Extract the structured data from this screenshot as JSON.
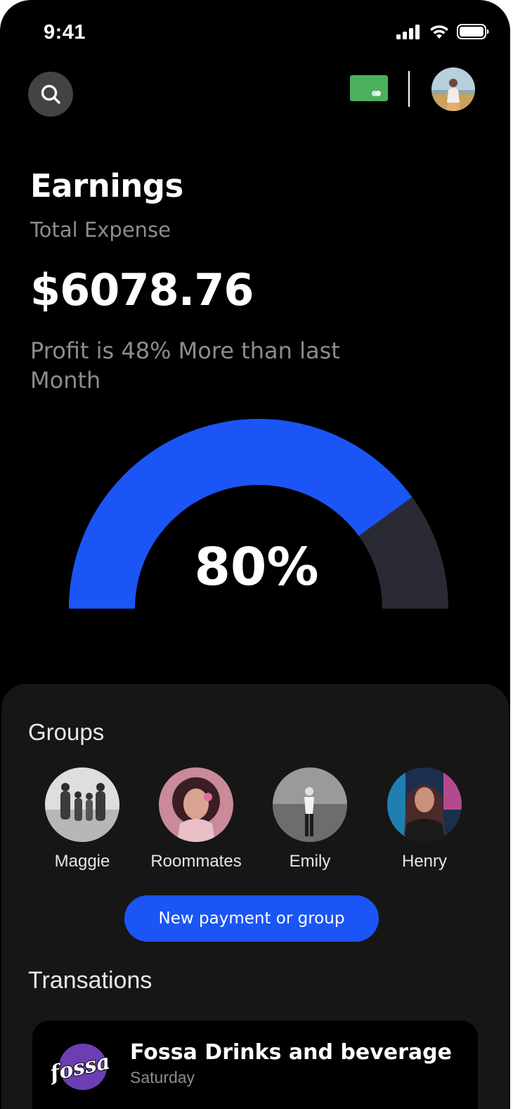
{
  "status_bar": {
    "time": "9:41"
  },
  "header": {
    "icons": [
      "search-icon",
      "card-icon",
      "profile-avatar"
    ]
  },
  "earnings": {
    "title": "Earnings",
    "subtitle": "Total Expense",
    "amount": "$6078.76",
    "profit_note": "Profit is 48% More than last Month",
    "progress_percent": 80,
    "progress_label": "80%"
  },
  "colors": {
    "accent": "#1b55f5",
    "gauge_track": "#2a2a35",
    "card_green": "#4caf5e",
    "sheet_bg": "#161616"
  },
  "groups": {
    "title": "Groups",
    "items": [
      {
        "label": "Maggie"
      },
      {
        "label": "Roommates"
      },
      {
        "label": "Emily"
      },
      {
        "label": "Henry"
      }
    ]
  },
  "actions": {
    "new_payment_label": "New payment or group"
  },
  "transactions": {
    "title": "Transations",
    "items": [
      {
        "name": "Fossa Drinks and beverage",
        "date": "Saturday",
        "logo_text": "fossa"
      }
    ]
  }
}
